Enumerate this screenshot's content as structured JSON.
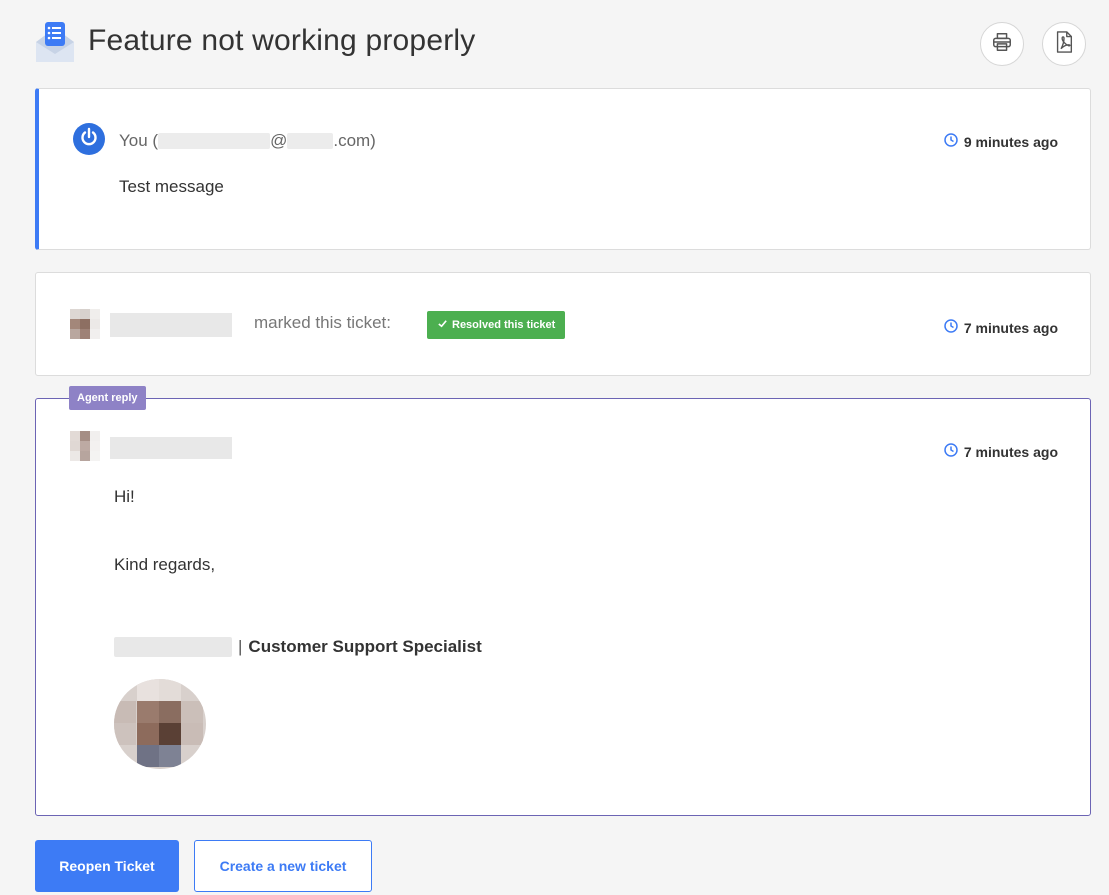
{
  "header": {
    "title": "Feature not working properly",
    "print_icon": "printer-icon",
    "pdf_icon": "pdf-icon",
    "ticket_icon": "envelope-list-icon"
  },
  "messages": [
    {
      "sender_prefix": "You (",
      "email_at": "@",
      "email_suffix": ".com)",
      "text": "Test message",
      "time": "9 minutes ago"
    }
  ],
  "status_event": {
    "action_text": "marked this ticket:",
    "badge_label": "Resolved this ticket",
    "time": "7 minutes ago"
  },
  "agent_reply": {
    "badge": "Agent reply",
    "time": "7 minutes ago",
    "greeting": "Hi!",
    "closing": "Kind regards,",
    "signature_separator": "|",
    "signature_title": "Customer Support Specialist"
  },
  "actions": {
    "reopen_label": "Reopen Ticket",
    "new_ticket_label": "Create a new ticket"
  },
  "colors": {
    "accent": "#3d7bf5",
    "resolved": "#4caf50",
    "agent": "#8e82c6"
  }
}
